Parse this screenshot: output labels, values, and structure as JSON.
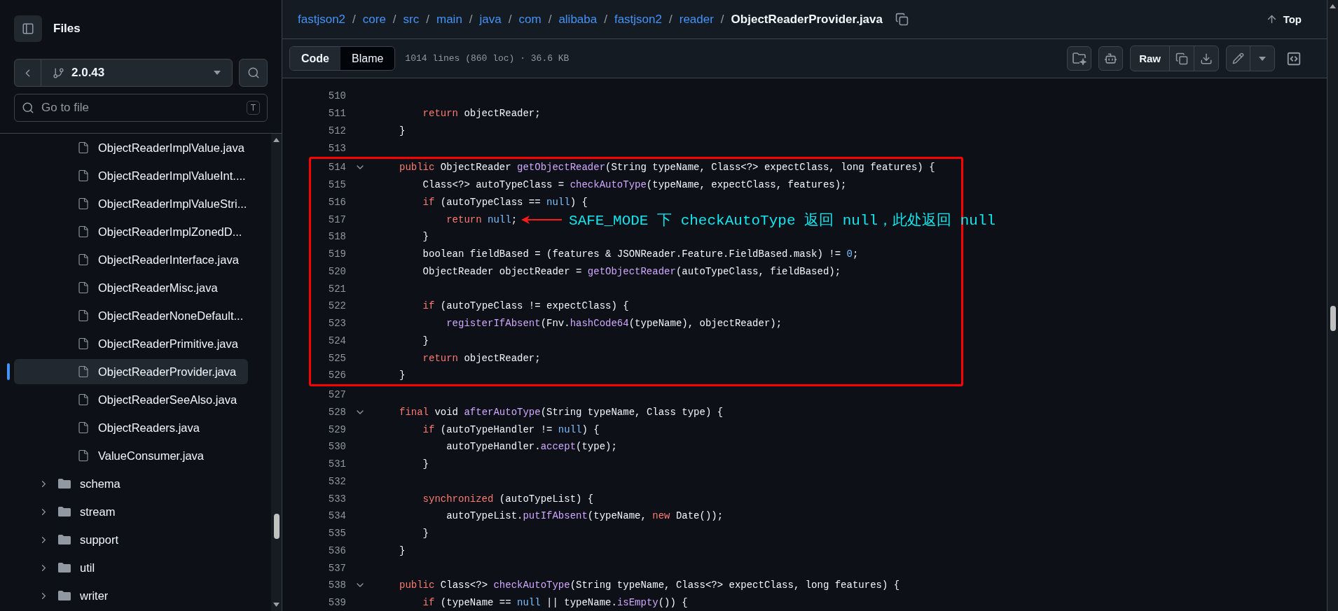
{
  "sidebar": {
    "title": "Files",
    "branch": "2.0.43",
    "search": {
      "placeholder": "Go to file",
      "shortcut": "T"
    },
    "items": [
      {
        "label": "ObjectReaderImplValue.java",
        "kind": "file",
        "selected": false
      },
      {
        "label": "ObjectReaderImplValueInt....",
        "kind": "file",
        "selected": false
      },
      {
        "label": "ObjectReaderImplValueStri...",
        "kind": "file",
        "selected": false
      },
      {
        "label": "ObjectReaderImplZonedD...",
        "kind": "file",
        "selected": false
      },
      {
        "label": "ObjectReaderInterface.java",
        "kind": "file",
        "selected": false
      },
      {
        "label": "ObjectReaderMisc.java",
        "kind": "file",
        "selected": false
      },
      {
        "label": "ObjectReaderNoneDefault...",
        "kind": "file",
        "selected": false
      },
      {
        "label": "ObjectReaderPrimitive.java",
        "kind": "file",
        "selected": false
      },
      {
        "label": "ObjectReaderProvider.java",
        "kind": "file",
        "selected": true
      },
      {
        "label": "ObjectReaderSeeAlso.java",
        "kind": "file",
        "selected": false
      },
      {
        "label": "ObjectReaders.java",
        "kind": "file",
        "selected": false
      },
      {
        "label": "ValueConsumer.java",
        "kind": "file",
        "selected": false
      },
      {
        "label": "schema",
        "kind": "folder",
        "expanded": false,
        "selected": false
      },
      {
        "label": "stream",
        "kind": "folder",
        "expanded": false,
        "selected": false
      },
      {
        "label": "support",
        "kind": "folder",
        "expanded": false,
        "selected": false
      },
      {
        "label": "util",
        "kind": "folder",
        "expanded": false,
        "selected": false
      },
      {
        "label": "writer",
        "kind": "folder",
        "expanded": false,
        "selected": false
      }
    ]
  },
  "breadcrumb": [
    "fastjson2",
    "/",
    "core",
    "/",
    "src",
    "/",
    "main",
    "/",
    "java",
    "/",
    "com",
    "/",
    "alibaba",
    "/",
    "fastjson2",
    "/",
    "reader",
    "/",
    "ObjectReaderProvider.java"
  ],
  "top_link": "Top",
  "tabs": [
    {
      "label": "Code",
      "selected": true
    },
    {
      "label": "Blame",
      "selected": false
    }
  ],
  "file_info": "1014 lines (860 loc) · 36.6 KB",
  "raw_button": "Raw",
  "code_blocks": [
    {
      "boxed": false,
      "lines": [
        {
          "number": "510"
        },
        {
          "number": "511",
          "tokens": [
            {
              "t": "    return",
              "color": "#ff7b72"
            },
            {
              "t": " objectReader;"
            }
          ]
        },
        {
          "number": "512",
          "tokens": [
            {
              "t": "}"
            }
          ]
        },
        {
          "number": "513"
        }
      ]
    },
    {
      "boxed": true,
      "lines": [
        {
          "number": "514",
          "expanded": true,
          "tokens": [
            {
              "t": "public",
              "color": "#ff7b72"
            },
            {
              "t": " ObjectReader "
            },
            {
              "t": "getObjectReader",
              "color": "#d2a8ff"
            },
            {
              "t": "(String typeName, Class<?> expectClass, long features) {"
            }
          ]
        },
        {
          "number": "515",
          "tokens": [
            {
              "t": "    Class<?> autoTypeClass = "
            },
            {
              "t": "checkAutoType",
              "color": "#d2a8ff"
            },
            {
              "t": "(typeName, expectClass, features);"
            }
          ]
        },
        {
          "number": "516",
          "tokens": [
            {
              "t": "    if",
              "color": "#ff7b72"
            },
            {
              "t": " (autoTypeClass == "
            },
            {
              "t": "null",
              "color": "#79c0ff"
            },
            {
              "t": ") {"
            }
          ]
        },
        {
          "number": "517",
          "note": "SAFE_MODE 下 checkAutoType 返回 null，此处返回 null",
          "tokens": [
            {
              "t": "        return ",
              "color": "#ff7b72"
            },
            {
              "t": "null",
              "color": "#79c0ff"
            },
            {
              "t": ";"
            }
          ]
        },
        {
          "number": "518",
          "tokens": [
            {
              "t": "    }"
            }
          ]
        },
        {
          "number": "519",
          "tokens": [
            {
              "t": "    boolean fieldBased = (features & JSONReader.Feature.FieldBased.mask) != "
            },
            {
              "t": "0",
              "color": "#79c0ff"
            },
            {
              "t": ";"
            }
          ]
        },
        {
          "number": "520",
          "tokens": [
            {
              "t": "    ObjectReader objectReader = "
            },
            {
              "t": "getObjectReader",
              "color": "#d2a8ff"
            },
            {
              "t": "(autoTypeClass, fieldBased);"
            }
          ]
        },
        {
          "number": "521"
        },
        {
          "number": "522",
          "tokens": [
            {
              "t": "    if",
              "color": "#ff7b72"
            },
            {
              "t": " (autoTypeClass != expectClass) {"
            }
          ]
        },
        {
          "number": "523",
          "tokens": [
            {
              "t": "        registerIfAbsent",
              "color": "#d2a8ff"
            },
            {
              "t": "(Fnv."
            },
            {
              "t": "hashCode64",
              "color": "#d2a8ff"
            },
            {
              "t": "(typeName), objectReader);"
            }
          ]
        },
        {
          "number": "524",
          "tokens": [
            {
              "t": "    }"
            }
          ]
        },
        {
          "number": "525",
          "tokens": [
            {
              "t": "    return",
              "color": "#ff7b72"
            },
            {
              "t": " objectReader;"
            }
          ]
        },
        {
          "number": "526",
          "tokens": [
            {
              "t": "}"
            }
          ]
        }
      ]
    },
    {
      "boxed": false,
      "lines": [
        {
          "number": "527"
        },
        {
          "number": "528",
          "expanded": true,
          "tokens": [
            {
              "t": "final",
              "color": "#ff7b72"
            },
            {
              "t": " void "
            },
            {
              "t": "afterAutoType",
              "color": "#d2a8ff"
            },
            {
              "t": "(String typeName, Class type) {"
            }
          ]
        },
        {
          "number": "529",
          "tokens": [
            {
              "t": "    if",
              "color": "#ff7b72"
            },
            {
              "t": " (autoTypeHandler != "
            },
            {
              "t": "null",
              "color": "#79c0ff"
            },
            {
              "t": ") {"
            }
          ]
        },
        {
          "number": "530",
          "tokens": [
            {
              "t": "        autoTypeHandler."
            },
            {
              "t": "accept",
              "color": "#d2a8ff"
            },
            {
              "t": "(type);"
            }
          ]
        },
        {
          "number": "531",
          "tokens": [
            {
              "t": "    }"
            }
          ]
        },
        {
          "number": "532"
        },
        {
          "number": "533",
          "tokens": [
            {
              "t": "    synchronized",
              "color": "#ff7b72"
            },
            {
              "t": " (autoTypeList) {"
            }
          ]
        },
        {
          "number": "534",
          "tokens": [
            {
              "t": "        autoTypeList."
            },
            {
              "t": "putIfAbsent",
              "color": "#d2a8ff"
            },
            {
              "t": "(typeName, "
            },
            {
              "t": "new",
              "color": "#ff7b72"
            },
            {
              "t": " Date());"
            }
          ]
        },
        {
          "number": "535",
          "tokens": [
            {
              "t": "    }"
            }
          ]
        },
        {
          "number": "536",
          "tokens": [
            {
              "t": "}"
            }
          ]
        },
        {
          "number": "537"
        },
        {
          "number": "538",
          "expanded": true,
          "tokens": [
            {
              "t": "public",
              "color": "#ff7b72"
            },
            {
              "t": " Class<?> "
            },
            {
              "t": "checkAutoType",
              "color": "#d2a8ff"
            },
            {
              "t": "(String typeName, Class<?> expectClass, long features) {"
            }
          ]
        },
        {
          "number": "539",
          "tokens": [
            {
              "t": "    if",
              "color": "#ff7b72"
            },
            {
              "t": " (typeName == "
            },
            {
              "t": "null",
              "color": "#79c0ff"
            },
            {
              "t": " || typeName."
            },
            {
              "t": "isEmpty",
              "color": "#d2a8ff"
            },
            {
              "t": "()) {"
            }
          ]
        }
      ]
    }
  ]
}
